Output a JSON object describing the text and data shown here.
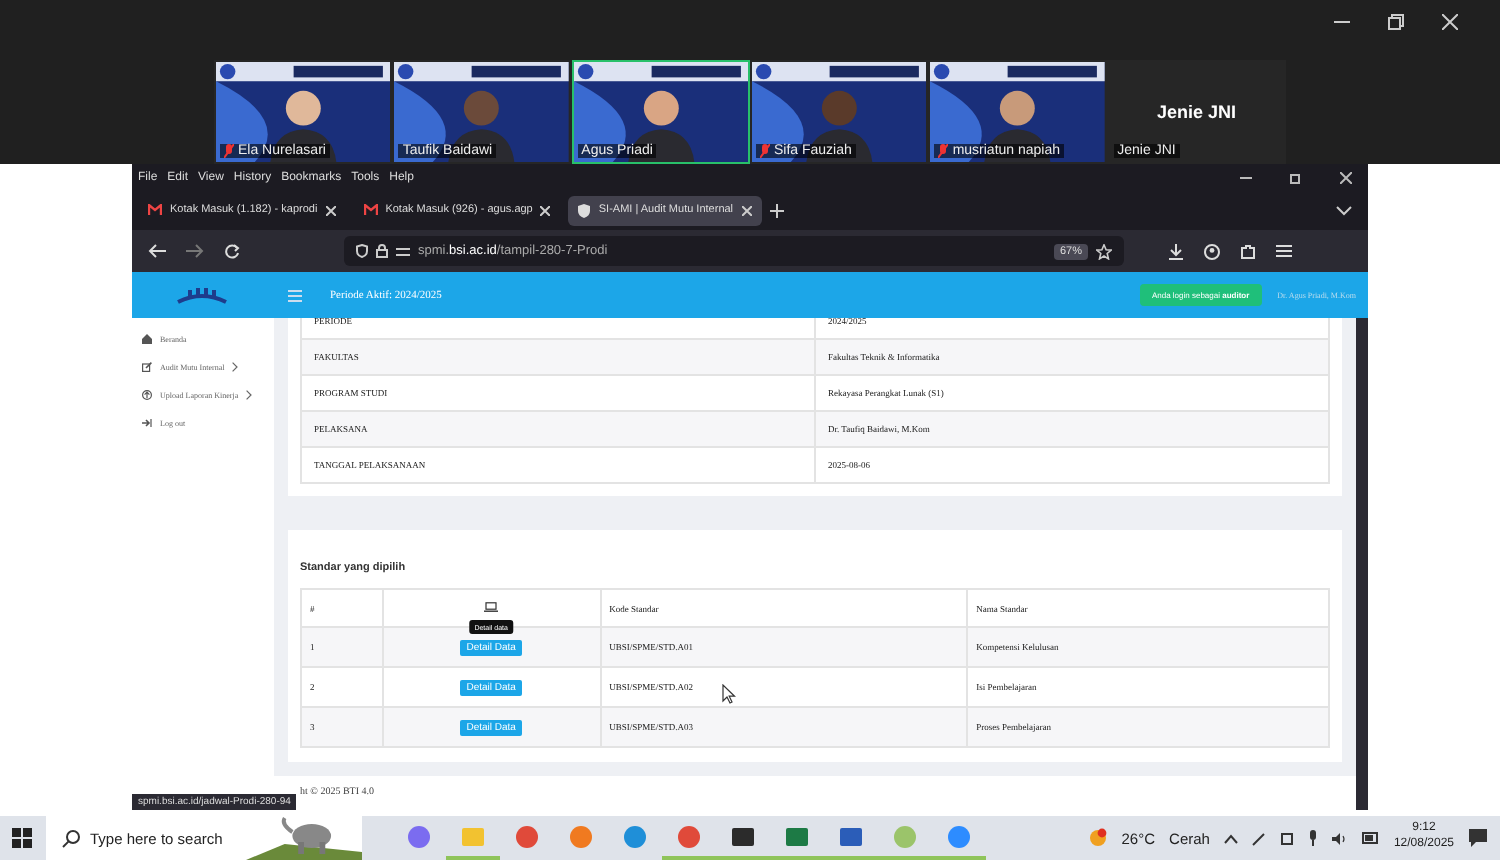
{
  "participants": [
    {
      "name": "Ela Nurelasari",
      "video": true,
      "speaking": false,
      "muted": true
    },
    {
      "name": "Taufik Baidawi",
      "video": true,
      "speaking": false,
      "muted": false
    },
    {
      "name": "Agus Priadi",
      "video": true,
      "speaking": true,
      "muted": false
    },
    {
      "name": "Sifa Fauziah",
      "video": true,
      "speaking": false,
      "muted": true
    },
    {
      "name": "musriatun napiah",
      "video": true,
      "speaking": false,
      "muted": true
    },
    {
      "name": "Jenie JNI",
      "video": false,
      "speaking": false,
      "muted": false,
      "card_name": "Jenie JNI"
    }
  ],
  "browser": {
    "menu": [
      "File",
      "Edit",
      "View",
      "History",
      "Bookmarks",
      "Tools",
      "Help"
    ],
    "tabs": [
      {
        "title": "Kotak Masuk (1.182) - kaprodi",
        "kind": "mail",
        "selected": false
      },
      {
        "title": "Kotak Masuk (926) - agus.agp",
        "kind": "mail",
        "selected": false
      },
      {
        "title": "SI-AMI | Audit Mutu Internal",
        "kind": "site",
        "selected": true
      }
    ],
    "address": "spmi.**bsi.ac.id**/tampil-280-7-Prodi",
    "zoom": "67%",
    "status_url": "spmi.bsi.ac.id/jadwal-Prodi-280-94"
  },
  "page": {
    "header": {
      "period": "Periode Aktif: 2024/2025",
      "login_badge": "Anda login sebagai **auditor**",
      "user": "Dr. Agus Priadi, M.Kom"
    },
    "sidebar": [
      {
        "label": "Beranda",
        "kind": "home",
        "expandable": false
      },
      {
        "label": "Audit Mutu Internal",
        "kind": "audit",
        "expandable": true
      },
      {
        "label": "Upload Laporan Kinerja",
        "kind": "upload",
        "expandable": true
      },
      {
        "label": "Log out",
        "kind": "logout",
        "expandable": false
      }
    ],
    "info_rows": [
      {
        "label": "PERIODE",
        "value": "2024/2025"
      },
      {
        "label": "FAKULTAS",
        "value": "Fakultas Teknik & Informatika"
      },
      {
        "label": "PROGRAM STUDI",
        "value": "Rekayasa Perangkat Lunak (S1)"
      },
      {
        "label": "PELAKSANA",
        "value": "Dr. Taufiq Baidawi, M.Kom"
      },
      {
        "label": "TANGGAL PELAKSANAAN",
        "value": "2025-08-06"
      }
    ],
    "standards": {
      "title": "Standar yang dipilih",
      "columns": [
        {
          "kind": "text",
          "label": "#"
        },
        {
          "kind": "icon"
        },
        {
          "kind": "text",
          "label": "Kode Standar"
        },
        {
          "kind": "text",
          "label": "Nama Standar"
        }
      ],
      "rows": [
        {
          "number": "1",
          "button": "Detail Data",
          "tooltip": "Detail data",
          "code": "UBSI/SPME/STD.A01",
          "name": "Kompetensi Kelulusan"
        },
        {
          "number": "2",
          "button": "Detail Data",
          "code": "UBSI/SPME/STD.A02",
          "name": "Isi Pembelajaran"
        },
        {
          "number": "3",
          "button": "Detail Data",
          "code": "UBSI/SPME/STD.A03",
          "name": "Proses Pembelajaran"
        }
      ]
    },
    "footer": "ht © 2025 BTI 4.0"
  },
  "taskbar": {
    "search_placeholder": "Type here to search",
    "apps": [
      {
        "kind": "copilot",
        "running": false
      },
      {
        "kind": "files",
        "running": true
      },
      {
        "kind": "chrome",
        "running": false
      },
      {
        "kind": "firefox",
        "running": false
      },
      {
        "kind": "edge",
        "running": false
      },
      {
        "kind": "chrome",
        "running": true
      },
      {
        "kind": "notes",
        "running": true
      },
      {
        "kind": "excel",
        "running": true
      },
      {
        "kind": "word",
        "running": true
      },
      {
        "kind": "paint",
        "running": true
      },
      {
        "kind": "zoom",
        "running": true
      }
    ],
    "weather": "26°C",
    "weather_text": "Cerah",
    "time": "9:12",
    "date": "12/08/2025"
  }
}
